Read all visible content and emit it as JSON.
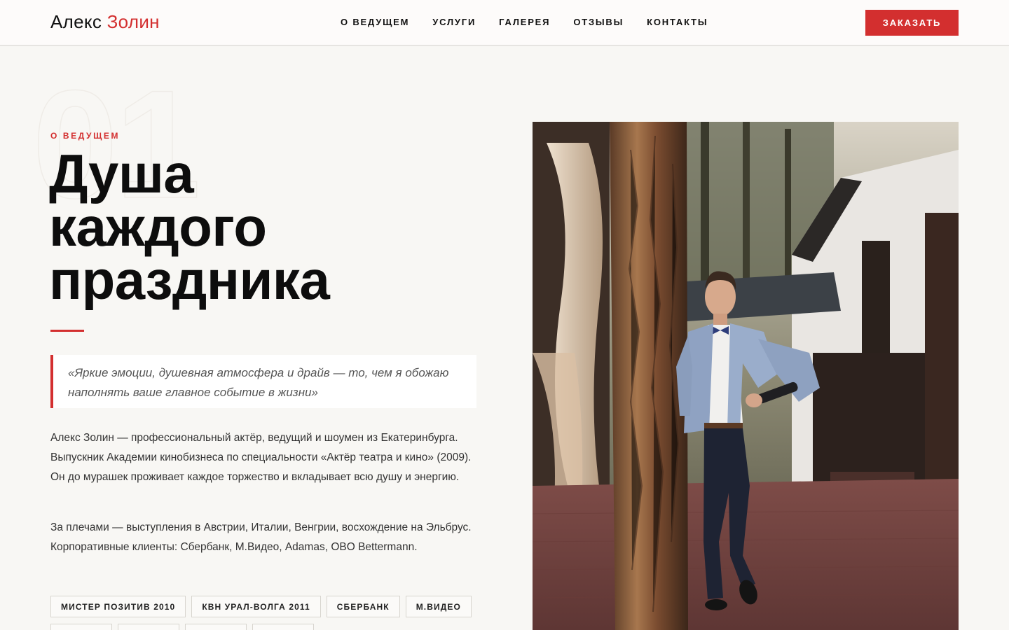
{
  "header": {
    "logo_first": "Алекс",
    "logo_second": "Золин",
    "nav": [
      "О ВЕДУЩЕМ",
      "УСЛУГИ",
      "ГАЛЕРЕЯ",
      "ОТЗЫВЫ",
      "КОНТАКТЫ"
    ],
    "cta_label": "ЗАКАЗАТЬ"
  },
  "hero": {
    "section_number": "01",
    "eyebrow": "О ВЕДУЩЕМ",
    "title_lines": [
      "Душа",
      "каждого",
      "праздника"
    ],
    "quote": "«Яркие эмоции, душевная атмосфера и драйв — то, чем я обожаю наполнять ваше главное событие в жизни»",
    "paragraphs": [
      "Алекс Золин — профессиональный актёр, ведущий и шоумен из Екатеринбурга. Выпускник Академии кинобизнеса по специальности «Актёр театра и кино» (2009). Он до мурашек проживает каждое торжество и вкладывает всю душу и энергию.",
      "За плечами — выступления в Австрии, Италии, Венгрии, восхождение на Эльбрус. Корпоративные клиенты: Сбербанк, М.Видео, Adamas, OBO Bettermann."
    ],
    "tags": [
      "МИСТЕР ПОЗИТИВ 2010",
      "КВН УРАЛ-ВОЛГА 2011",
      "СБЕРБАНК",
      "М.ВИДЕО"
    ]
  },
  "colors": {
    "accent": "#d32f2f",
    "background": "#f8f7f4",
    "text": "#111111"
  }
}
